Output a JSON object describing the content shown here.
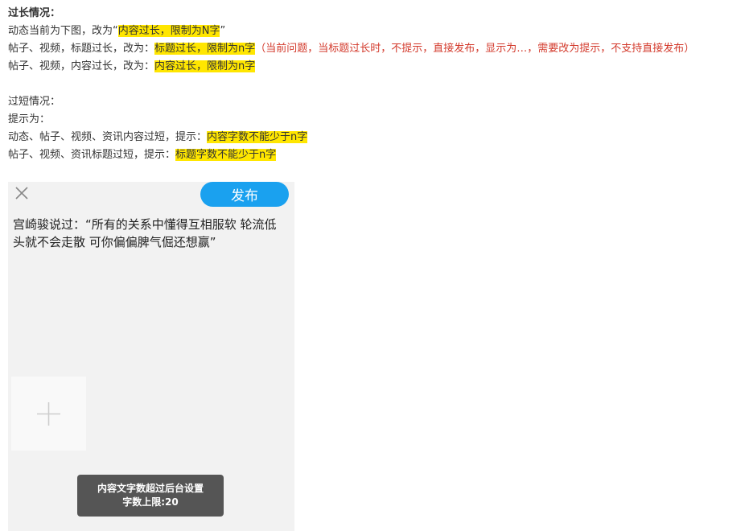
{
  "doc": {
    "l1": "过长情况：",
    "l2_pre": "动态当前为下图，改为“",
    "l2_hl": "内容过长，限制为N字",
    "l2_post": "”",
    "l3_pre": "帖子、视频，标题过长，改为：",
    "l3_hl": "标题过长，限制为n字",
    "l3_red": "（当前问题，当标题过长时，不提示，直接发布，显示为…，需要改为提示，不支持直接发布）",
    "l4_pre": "帖子、视频，内容过长，改为：",
    "l4_hl": "内容过长，限制为n字",
    "l5": "过短情况：",
    "l6": "提示为：",
    "l7_pre": "动态、帖子、视频、资讯内容过短，提示：",
    "l7_hl": "内容字数不能少于n字",
    "l8_pre": "帖子、视频、资讯标题过短，提示：",
    "l8_hl": "标题字数不能少于n字"
  },
  "phone": {
    "publish_label": "发布",
    "post_text": "宫崎骏说过：“所有的关系中懂得互相服软 轮流低头就不会走散 可你偏偏脾气倔还想赢”",
    "toast_line1": "内容文字数超过后台设置",
    "toast_line2": "字数上限:20",
    "icons": [
      "close-icon",
      "plus-icon"
    ],
    "colors": {
      "accent": "#1aa1ef",
      "highlight": "#ffe600",
      "warning_text": "#d33a2c"
    }
  }
}
